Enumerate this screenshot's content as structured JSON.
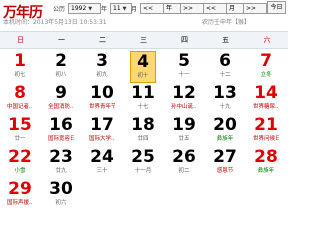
{
  "header": {
    "app_title": "万年历",
    "gregorian_label": "公历",
    "year_value": "1992",
    "year_unit": "年",
    "month_value": "11",
    "month_unit": "月",
    "nav_buttons": [
      "<<",
      "年",
      ">>",
      "<<",
      "月",
      ">>"
    ],
    "today_button": "今日",
    "local_time_label": "本机时间：",
    "local_time_value": "2013年5月13日 10:53:31",
    "lunar_info": "农历壬申年【猴】"
  },
  "weekdays": [
    {
      "label": "日",
      "weekend": true
    },
    {
      "label": "一",
      "weekend": false
    },
    {
      "label": "二",
      "weekend": false
    },
    {
      "label": "三",
      "weekend": false
    },
    {
      "label": "四",
      "weekend": false
    },
    {
      "label": "五",
      "weekend": false
    },
    {
      "label": "六",
      "weekend": true
    }
  ],
  "days": [
    {
      "num": "1",
      "sub": "初七",
      "sub_type": "lunar"
    },
    {
      "num": "2",
      "sub": "初八",
      "sub_type": "lunar"
    },
    {
      "num": "3",
      "sub": "初九",
      "sub_type": "lunar"
    },
    {
      "num": "4",
      "sub": "初十",
      "sub_type": "lunar",
      "today": true
    },
    {
      "num": "5",
      "sub": "十一",
      "sub_type": "lunar"
    },
    {
      "num": "6",
      "sub": "十二",
      "sub_type": "lunar"
    },
    {
      "num": "7",
      "sub": "立冬",
      "sub_type": "term"
    },
    {
      "num": "8",
      "sub": "中国记者...",
      "sub_type": "holiday"
    },
    {
      "num": "9",
      "sub": "全国消防...",
      "sub_type": "holiday"
    },
    {
      "num": "10",
      "sub": "世界青年节",
      "sub_type": "holiday"
    },
    {
      "num": "11",
      "sub": "十七",
      "sub_type": "lunar"
    },
    {
      "num": "12",
      "sub": "孙中山诞...",
      "sub_type": "holiday"
    },
    {
      "num": "13",
      "sub": "十九",
      "sub_type": "lunar"
    },
    {
      "num": "14",
      "sub": "世界糖尿...",
      "sub_type": "holiday"
    },
    {
      "num": "15",
      "sub": "廿一",
      "sub_type": "lunar"
    },
    {
      "num": "16",
      "sub": "国际宽容日",
      "sub_type": "holiday"
    },
    {
      "num": "17",
      "sub": "国际大学...",
      "sub_type": "holiday"
    },
    {
      "num": "18",
      "sub": "廿四",
      "sub_type": "lunar"
    },
    {
      "num": "19",
      "sub": "廿五",
      "sub_type": "lunar"
    },
    {
      "num": "20",
      "sub": "彝族年",
      "sub_type": "term"
    },
    {
      "num": "21",
      "sub": "世界问候日",
      "sub_type": "holiday"
    },
    {
      "num": "22",
      "sub": "小雪",
      "sub_type": "term"
    },
    {
      "num": "23",
      "sub": "廿九",
      "sub_type": "lunar"
    },
    {
      "num": "24",
      "sub": "三十",
      "sub_type": "lunar"
    },
    {
      "num": "25",
      "sub": "十一月",
      "sub_type": "lunar"
    },
    {
      "num": "26",
      "sub": "初二",
      "sub_type": "lunar"
    },
    {
      "num": "27",
      "sub": "感恩节",
      "sub_type": "holiday"
    },
    {
      "num": "28",
      "sub": "彝族年",
      "sub_type": "term"
    },
    {
      "num": "29",
      "sub": "国际声援...",
      "sub_type": "holiday"
    },
    {
      "num": "30",
      "sub": "初六",
      "sub_type": "lunar"
    }
  ],
  "colors": {
    "weekend": "#e00000",
    "holiday": "#c00000",
    "term": "#008000",
    "today_bg": "#ffd875",
    "title": "#c00000"
  }
}
